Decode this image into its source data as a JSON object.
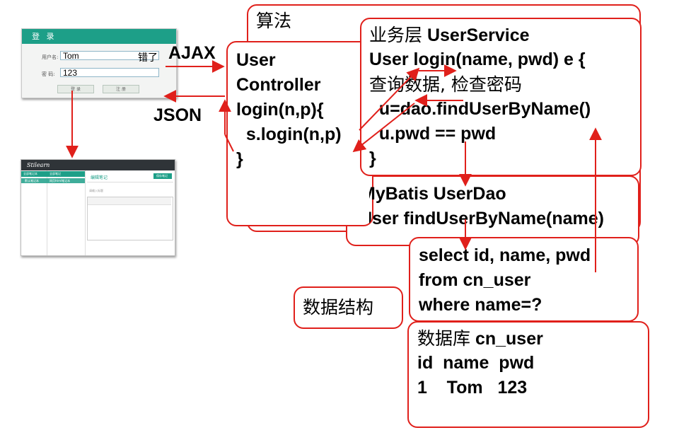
{
  "login": {
    "title": "登 录",
    "user_label": "用户名:",
    "user_value": "Tom",
    "pwd_label": "密 码:",
    "pwd_value": "123",
    "login_button": "登 录",
    "register_button": "注 册",
    "error_text": "错了"
  },
  "note_app": {
    "logo": "Stilearn",
    "tab_notebooks": "全部笔记本",
    "tab_notes": "全部笔记",
    "item_default": "默认笔记本",
    "item_note": "网页html笔记本",
    "edit_title": "编辑笔记",
    "save_button": "保存笔记",
    "title_placeholder": "请输入标题"
  },
  "labels": {
    "ajax": "AJAX",
    "json": "JSON"
  },
  "boxes": {
    "algorithm": "算法",
    "controller": [
      "User",
      "Controller",
      "login(n,p){",
      "  s.login(n,p)",
      "}"
    ],
    "service": [
      "业务层 UserService",
      "User login(name, pwd) e {",
      "查询数据, 检查密码",
      "  u=dao.findUserByName()",
      "  u.pwd == pwd",
      "}"
    ],
    "dao": [
      "MyBatis UserDao",
      "User findUserByName(name)"
    ],
    "sql": [
      "select id, name, pwd",
      "from cn_user",
      "where name=?"
    ],
    "data_structure": "数据结构",
    "database": [
      "数据库 cn_user",
      "id  name  pwd",
      "1    Tom   123"
    ]
  },
  "colors": {
    "accent": "#e0201b",
    "login_bar": "#1d9f88",
    "note_topbar": "#2f3438"
  }
}
